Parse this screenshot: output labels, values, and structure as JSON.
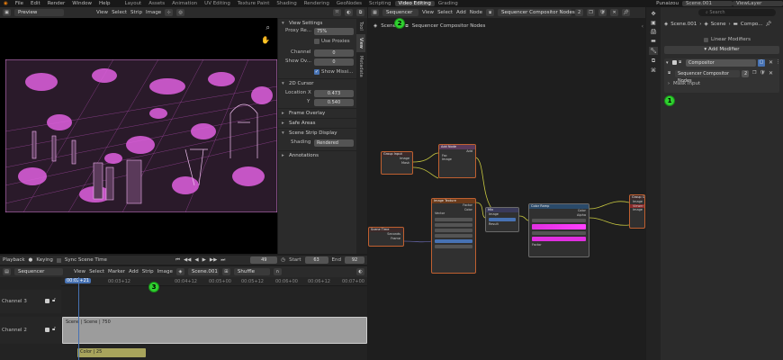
{
  "topbar": {
    "menus": [
      "File",
      "Edit",
      "Render",
      "Window",
      "Help"
    ],
    "workspaces": [
      "Layout",
      "Assets",
      "Animation",
      "UV Editing",
      "Texture Paint",
      "Shading",
      "Rendering",
      "GeoNodes",
      "Scripting",
      "Video Editing",
      "Grading"
    ],
    "active_workspace": "Video Editing",
    "right": [
      "Punaizou",
      "Scene.001",
      "ViewLayer"
    ]
  },
  "preview": {
    "editor": "Sequencer",
    "mode": "Preview",
    "menus": [
      "View",
      "Select",
      "Strip",
      "Image"
    ]
  },
  "sidebar": {
    "tabs": [
      "Tool",
      "View",
      "Metadata"
    ],
    "view_settings": {
      "title": "View Settings",
      "proxy_label": "Proxy Re...",
      "proxy_value": "75%",
      "use_proxies": "Use Proxies",
      "channel_label": "Channel",
      "channel_value": "0",
      "show_ov_label": "Show Ov...",
      "show_ov_value": "0",
      "show_missing": "Show Missi..."
    },
    "cursor_2d": {
      "title": "2D Cursor",
      "location_x_label": "Location X",
      "location_x_value": "0.473",
      "y_label": "Y",
      "y_value": "0.540"
    },
    "frame_overlay": "Frame Overlay",
    "safe_areas": "Safe Areas",
    "scene_strip_display": {
      "title": "Scene Strip Display",
      "shading_label": "Shading",
      "shading_value": "Rendered"
    },
    "annotations": "Annotations"
  },
  "playback": {
    "menus": [
      "Playback",
      "Keying"
    ],
    "sync": "Sync Scene Time",
    "frame": "49",
    "start_label": "Start",
    "start_value": "63",
    "end_label": "End",
    "end_value": "92"
  },
  "timeline": {
    "editor": "Sequencer",
    "menus": [
      "View",
      "Select",
      "Marker",
      "Add",
      "Strip",
      "Image"
    ],
    "scene": "Scene.001",
    "snap": "Shuffle",
    "current_time": "00:02+21",
    "ticks": [
      "00:03+12",
      "00:04+12",
      "00:05+00",
      "00:05+12",
      "00:06+00",
      "00:06+12",
      "00:07+00"
    ],
    "channels": [
      "Channel 3",
      "Channel 2"
    ],
    "strip_scene": "Scene | Scene | 750",
    "strip_color": "Color | 25"
  },
  "compositor": {
    "editor": "Sequencer",
    "menus": [
      "View",
      "Select",
      "Add",
      "Node"
    ],
    "tree_name": "Sequencer Compositor Nodes",
    "users": "2",
    "breadcrumb": [
      "Scene",
      "Sequencer Compositor Nodes"
    ],
    "nodes": {
      "group_input": {
        "title": "Group Input",
        "rows": [
          "Image",
          "Mask"
        ]
      },
      "add_node": {
        "title": "Add Node",
        "rows": [
          "Add",
          "Fac",
          "Image"
        ]
      },
      "image_node": {
        "title": "Image Texture",
        "rows": [
          "Factor",
          "Color",
          "Vector"
        ]
      },
      "color_ramp": {
        "title": "Color Ramp",
        "rows": [
          "Color",
          "Alpha",
          "Factor"
        ]
      },
      "mix": {
        "title": "Mix",
        "rows": [
          "Image",
          "Result"
        ]
      },
      "group_output": {
        "title": "Group Output",
        "rows": [
          "Image",
          "Image"
        ]
      },
      "scene_time": {
        "title": "Scene Time",
        "rows": [
          "Seconds",
          "Frame"
        ]
      },
      "viewer": {
        "title": "Viewer",
        "rows": [
          "Image"
        ]
      }
    }
  },
  "properties": {
    "breadcrumb_left": "Scene.001",
    "breadcrumb_mid": "Scene",
    "breadcrumb_right": "Compo...",
    "linear_modifiers": "Linear Modifiers",
    "add_modifier": "Add Modifier",
    "modifier_name": "Compositor",
    "modifier_tree": "Sequencer Compositor Nodes",
    "modifier_users": "2",
    "mask_input": "Mask Input",
    "search_placeholder": "Search"
  },
  "badges": [
    "1",
    "2",
    "3"
  ],
  "colors": {
    "accent": "#4772b3",
    "active_tab": "#3a3a3a",
    "strip_scene": "#999999",
    "strip_color": "#a8a45c",
    "magenta": "#e02fe0",
    "badge": "#2fd12f"
  }
}
